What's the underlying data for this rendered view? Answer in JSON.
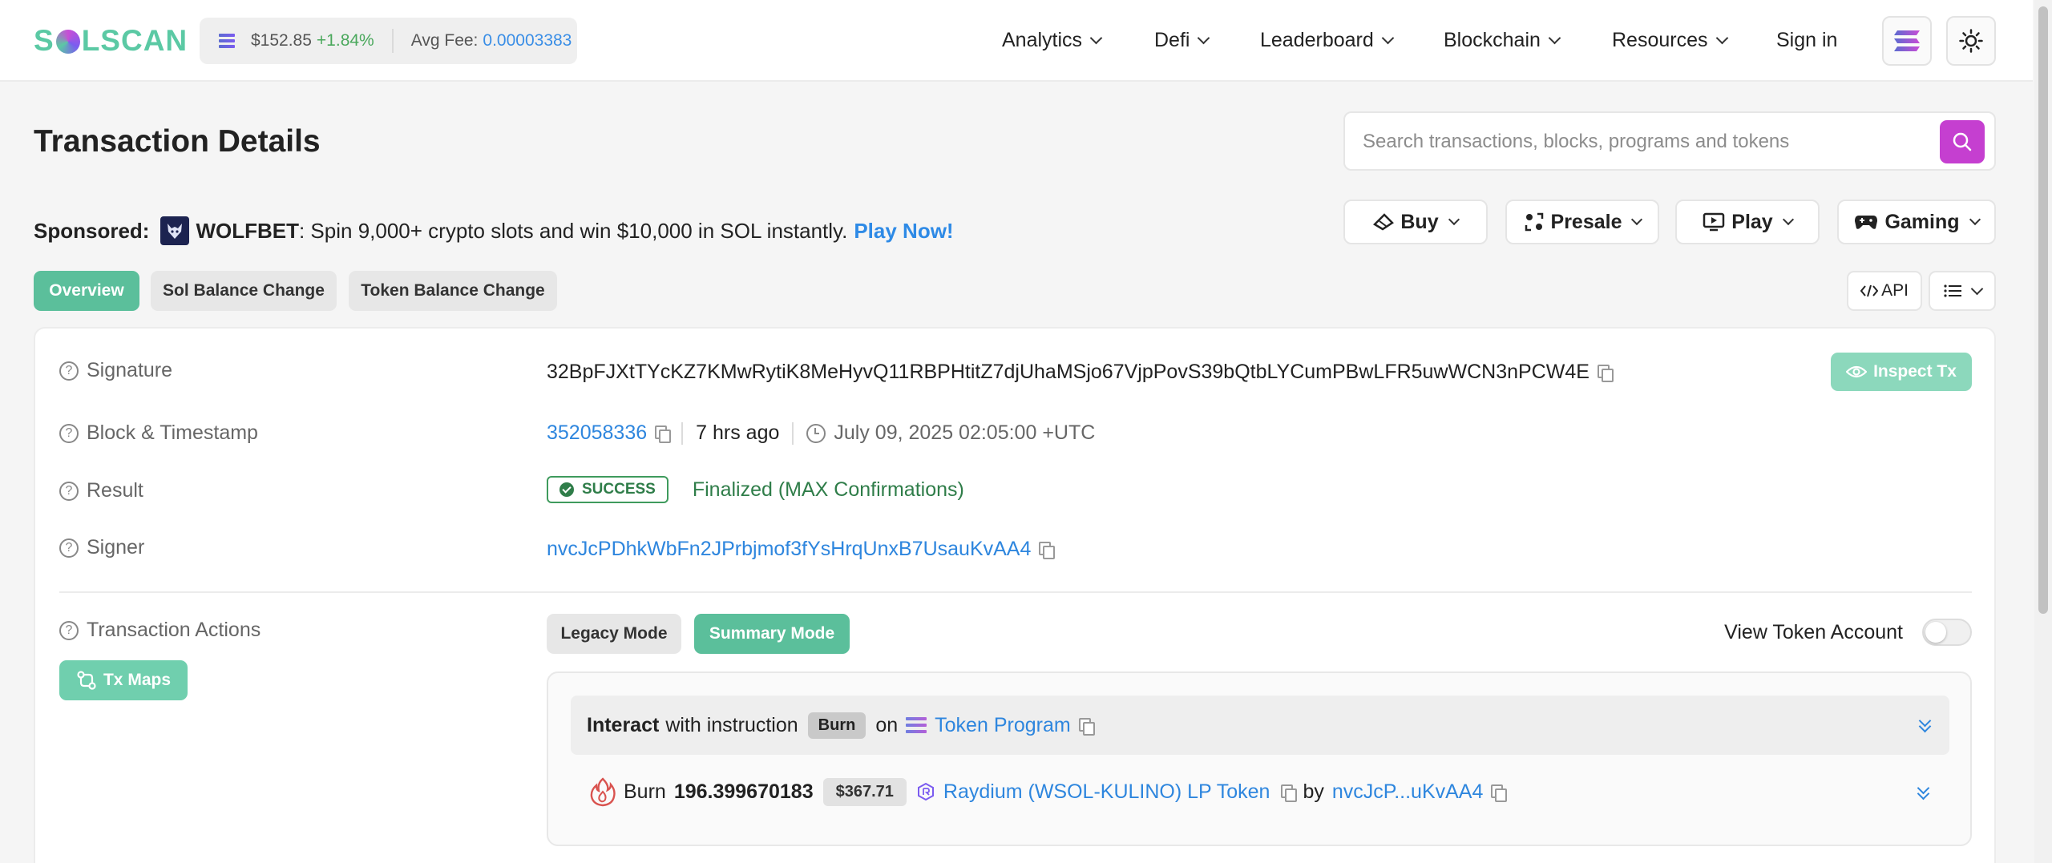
{
  "header": {
    "logo": "SOLSCAN",
    "price": "$152.85",
    "price_change": "+1.84%",
    "avg_fee_label": "Avg Fee:",
    "avg_fee": "0.00003383",
    "nav": [
      {
        "label": "Analytics"
      },
      {
        "label": "Defi"
      },
      {
        "label": "Leaderboard"
      },
      {
        "label": "Blockchain"
      },
      {
        "label": "Resources"
      }
    ],
    "sign_in": "Sign in"
  },
  "page": {
    "title": "Transaction Details",
    "search_placeholder": "Search transactions, blocks, programs and tokens"
  },
  "sponsored": {
    "label": "Sponsored:",
    "brand": "WOLFBET",
    "text": ": Spin 9,000+ crypto slots and win $10,000 in SOL instantly.",
    "cta": "Play Now!"
  },
  "dropdowns": [
    {
      "label": "Buy"
    },
    {
      "label": "Presale"
    },
    {
      "label": "Play"
    },
    {
      "label": "Gaming"
    }
  ],
  "tabs": [
    {
      "label": "Overview",
      "active": true
    },
    {
      "label": "Sol Balance Change",
      "active": false
    },
    {
      "label": "Token Balance Change",
      "active": false
    }
  ],
  "api_label": "API",
  "details": {
    "signature_label": "Signature",
    "signature": "32BpFJXtTYcKZ7KMwRytiK8MeHyvQ11RBPHtitZ7djUhaMSjo67VjpPovS39bQtbLYCumPBwLFR5uwWCN3nPCW4E",
    "inspect_label": "Inspect Tx",
    "block_label": "Block & Timestamp",
    "block": "352058336",
    "ago": "7 hrs ago",
    "timestamp": "July 09, 2025 02:05:00 +UTC",
    "result_label": "Result",
    "result_status": "SUCCESS",
    "result_text": "Finalized (MAX Confirmations)",
    "signer_label": "Signer",
    "signer": "nvcJcPDhkWbFn2JPrbjmof3fYsHrqUnxB7UsauKvAA4",
    "actions_label": "Transaction Actions",
    "tx_maps_label": "Tx Maps",
    "legacy_mode": "Legacy Mode",
    "summary_mode": "Summary Mode",
    "view_token_account": "View Token Account",
    "instruction": {
      "interact": "Interact",
      "with_text": "with instruction",
      "badge": "Burn",
      "on_text": "on",
      "program": "Token Program"
    },
    "burn": {
      "label": "Burn",
      "amount": "196.399670183",
      "usd": "$367.71",
      "token": "Raydium (WSOL-KULINO) LP Token",
      "by_text": "by",
      "by_account": "nvcJcP...uKvAA4"
    }
  }
}
